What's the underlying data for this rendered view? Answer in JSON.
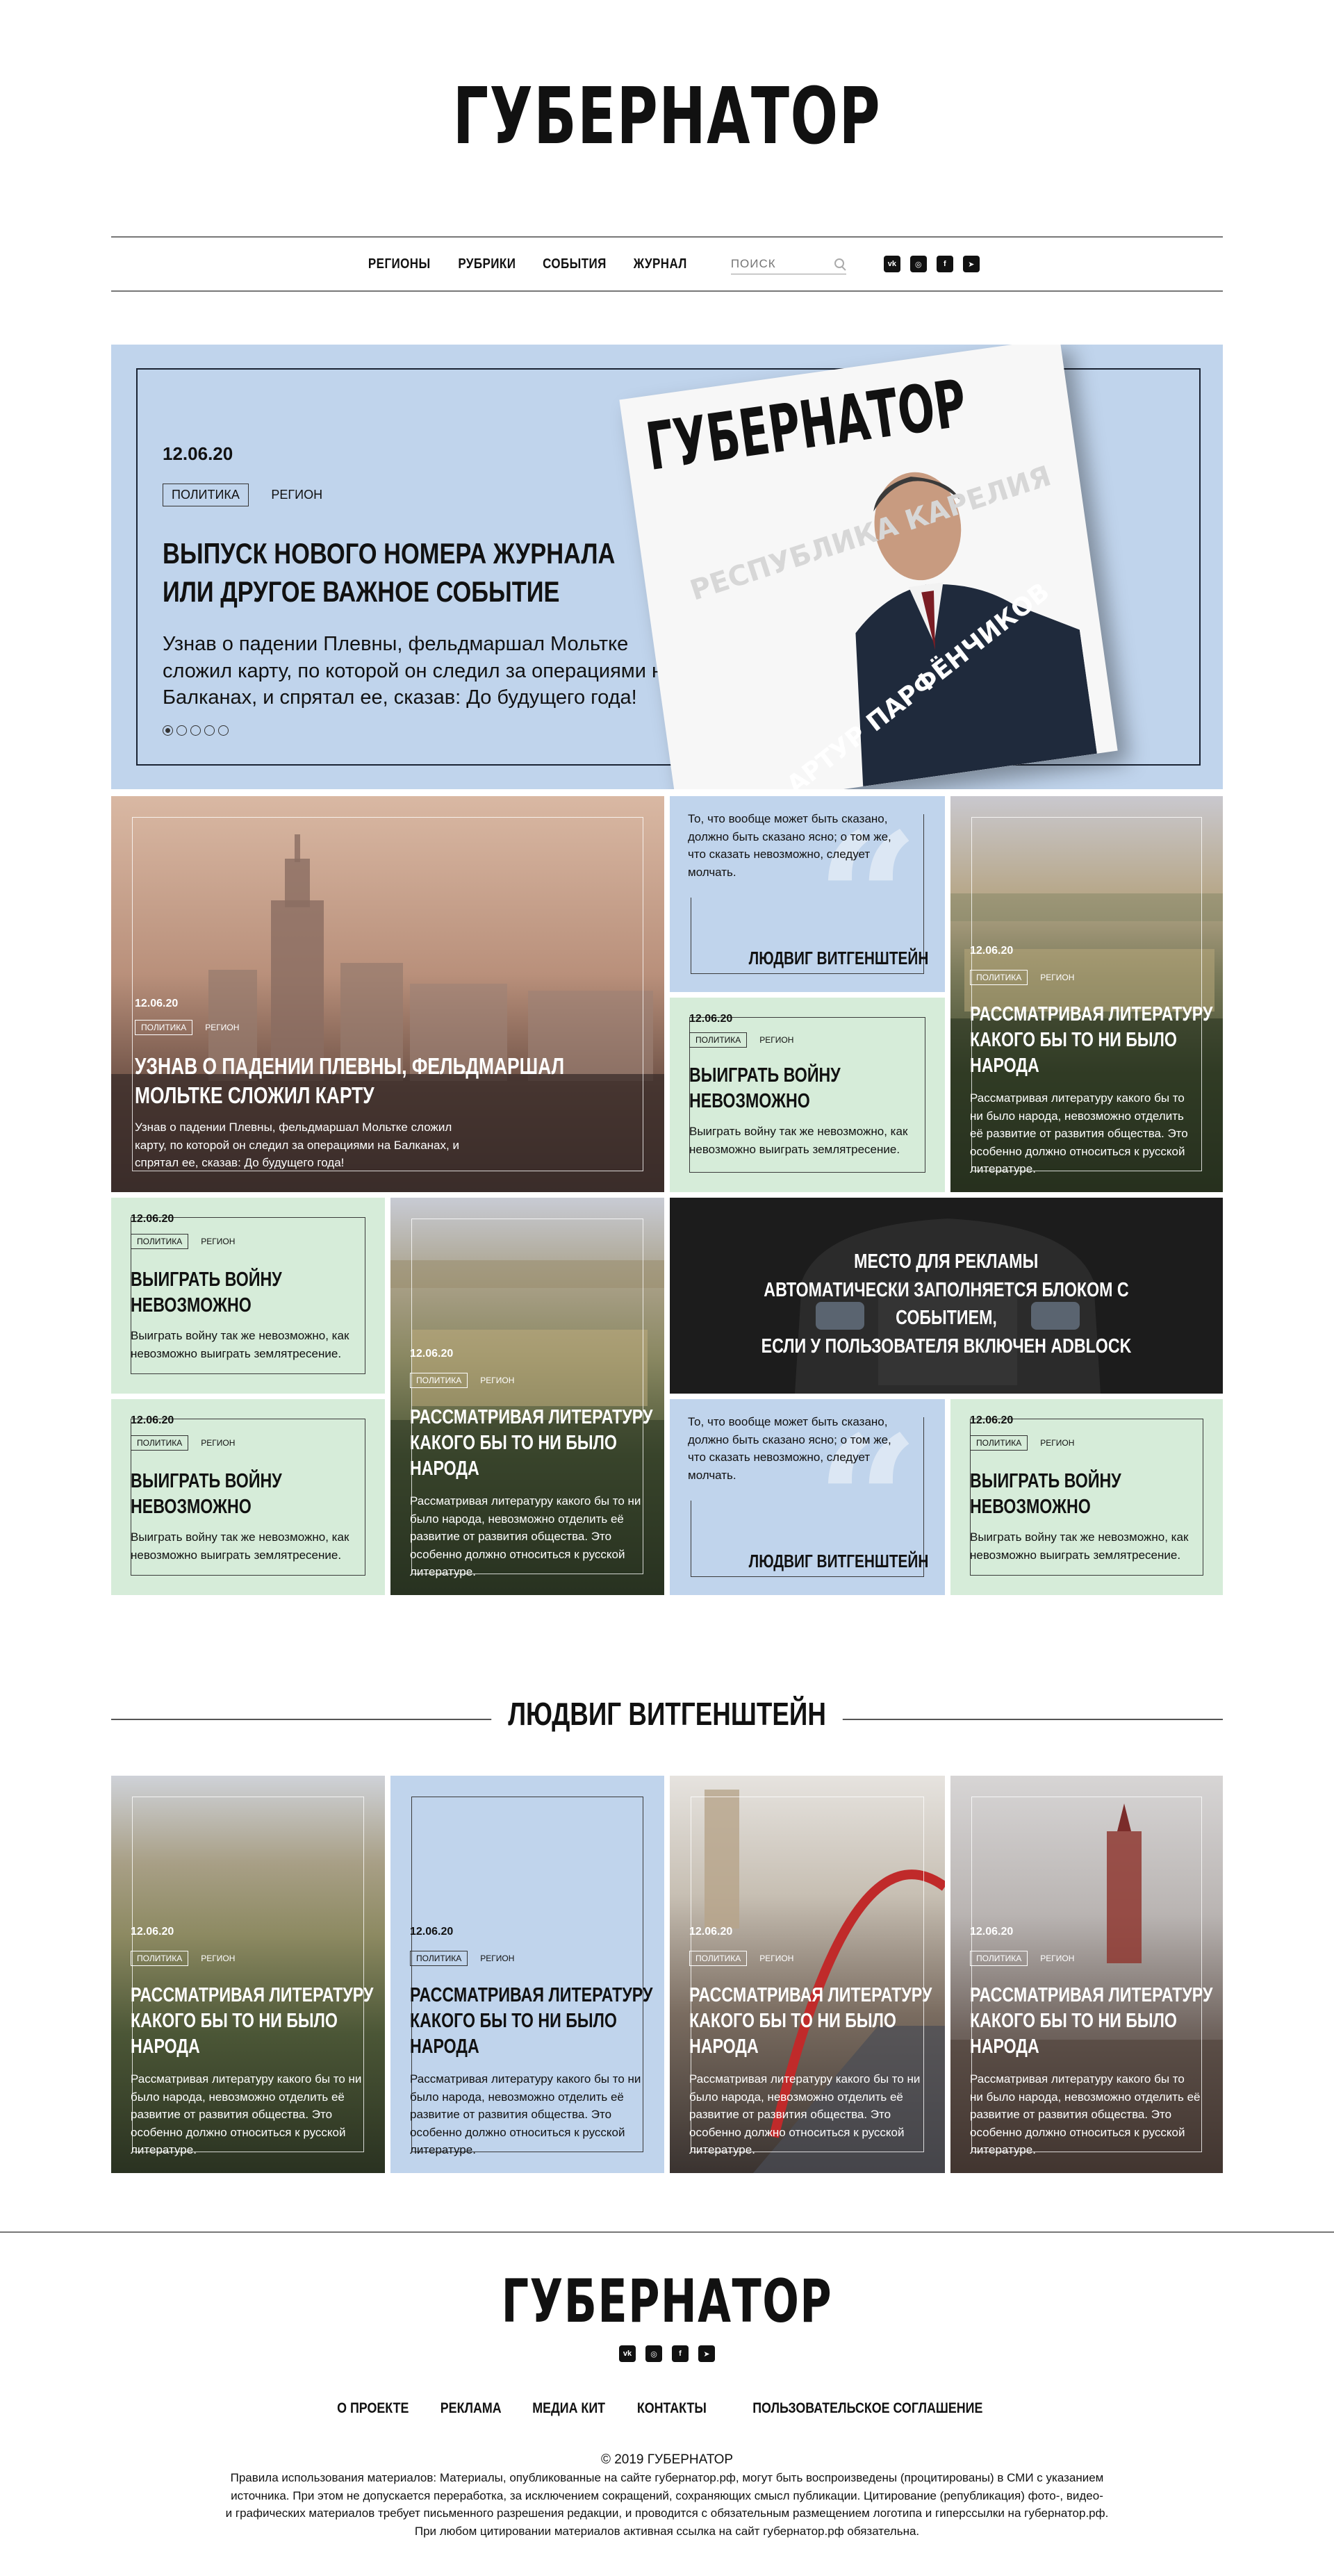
{
  "header": {
    "logo": "ГУБЕРНАТОР",
    "nav": [
      "РЕГИОНЫ",
      "РУБРИКИ",
      "СОБЫТИЯ",
      "ЖУРНАЛ"
    ],
    "search_placeholder": "ПОИСК",
    "socials": [
      "vk-icon",
      "instagram-icon",
      "facebook-icon",
      "telegram-icon"
    ]
  },
  "hero": {
    "date": "12.06.20",
    "tag": "ПОЛИТИКА",
    "region": "РЕГИОН",
    "title_line1": "ВЫПУСК НОВОГО НОМЕРА ЖУРНАЛА",
    "title_line2": "ИЛИ ДРУГОЕ ВАЖНОЕ СОБЫТИЕ",
    "text": "Узнав о падении Плевны, фельдмаршал Мольтке сложил карту, по которой он следил за операциями на Балканах, и спрятал ее, сказав: До будущего года!",
    "magazine": {
      "title": "ГУБЕРНАТОР",
      "side": "РЕСПУБЛИКА КАРЕЛИЯ",
      "name": "АРТУР ПАРФЁНЧИКОВ"
    }
  },
  "cards": {
    "big": {
      "date": "12.06.20",
      "tag": "ПОЛИТИКА",
      "region": "РЕГИОН",
      "title1": "УЗНАВ О ПАДЕНИИ ПЛЕВНЫ, ФЕЛЬДМАРШАЛ",
      "title2": "МОЛЬТКЕ СЛОЖИЛ КАРТУ",
      "text": "Узнав о падении Плевны, фельдмаршал Мольтке сложил карту, по которой он следил за операциями на Балканах, и спрятал ее, сказав: До будущего года!"
    },
    "quote": {
      "text": "То, что вообще может быть сказано, должно быть сказано ясно; о том же, что сказать невозможно, следует молчать.",
      "author": "ЛЮДВИГ ВИТГЕНШТЕЙН"
    },
    "war": {
      "date": "12.06.20",
      "tag": "ПОЛИТИКА",
      "region": "РЕГИОН",
      "title1": "ВЫИГРАТЬ ВОЙНУ",
      "title2": "НЕВОЗМОЖНО",
      "text": "Выиграть войну так же невозможно, как невозможно выиграть землятресение."
    },
    "lit": {
      "date": "12.06.20",
      "tag": "ПОЛИТИКА",
      "region": "РЕГИОН",
      "title1": "РАССМАТРИВАЯ ЛИТЕРАТУРУ",
      "title2": "КАКОГО БЫ ТО НИ БЫЛО",
      "title3": "НАРОДА",
      "text": "Рассматривая литературу какого бы то ни было народа, невозможно отделить её развитие от развития общества. Это особенно должно относиться к русской литературе."
    },
    "ad": {
      "line1": "МЕСТО ДЛЯ РЕКЛАМЫ",
      "line2": "АВТОМАТИЧЕСКИ ЗАПОЛНЯЕТСЯ БЛОКОМ С СОБЫТИЕМ,",
      "line3": "ЕСЛИ У ПОЛЬЗОВАТЕЛЯ ВКЛЮЧЕН ADBLOCK"
    }
  },
  "section": {
    "title": "ЛЮДВИГ ВИТГЕНШТЕЙН"
  },
  "footer": {
    "logo": "ГУБЕРНАТОР",
    "links": [
      "О ПРОЕКТЕ",
      "РЕКЛАМА",
      "МЕДИА КИТ",
      "КОНТАКТЫ",
      "ПОЛЬЗОВАТЕЛЬСКОЕ СОГЛАШЕНИЕ"
    ],
    "copyright": "© 2019 ГУБЕРНАТОР",
    "rules_line1": "Правила использования материалов: Материалы, опубликованные на сайте губернатор.рф, могут быть воспроизведены (процитированы) в СМИ с указанием",
    "rules_line2": "источника. При этом не допускается переработка, за исключением сокращений, сохраняющих смысл публикации. Цитирование (републикация) фото-, видео-",
    "rules_line3": "и графических материалов требует письменного разрешения редакции, и проводится с обязательным размещением логотипа и гиперссылки на губернатор.рф.",
    "rules_line4": "При любом цитировании материалов активная ссылка на сайт губернатор.рф обязательна."
  },
  "colors": {
    "blue": "#c0d4ec",
    "green": "#d6ecd9",
    "dark": "#1c1c1c"
  }
}
